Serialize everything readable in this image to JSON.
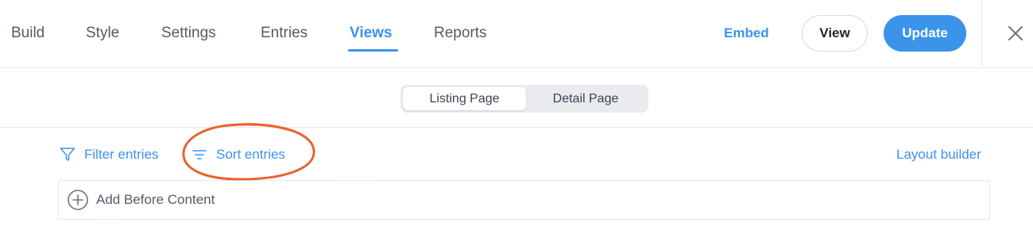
{
  "nav": {
    "tabs": [
      {
        "label": "Build",
        "active": false
      },
      {
        "label": "Style",
        "active": false
      },
      {
        "label": "Settings",
        "active": false
      },
      {
        "label": "Entries",
        "active": false
      },
      {
        "label": "Views",
        "active": true
      },
      {
        "label": "Reports",
        "active": false
      }
    ]
  },
  "header_actions": {
    "embed_label": "Embed",
    "view_label": "View",
    "update_label": "Update",
    "close_icon": "close-icon"
  },
  "view_switch": {
    "options": [
      "Listing Page",
      "Detail Page"
    ],
    "selected": "Listing Page"
  },
  "toolbar": {
    "filter_label": "Filter entries",
    "filter_icon": "filter-icon",
    "sort_label": "Sort entries",
    "sort_icon": "sort-icon",
    "layout_builder_label": "Layout builder"
  },
  "content": {
    "add_before_label": "Add Before Content",
    "add_icon": "plus-circle-icon"
  },
  "colors": {
    "accent": "#3b93ea",
    "annotation": "#e8622c",
    "text": "#3c4350",
    "border": "#e6e8ec"
  }
}
